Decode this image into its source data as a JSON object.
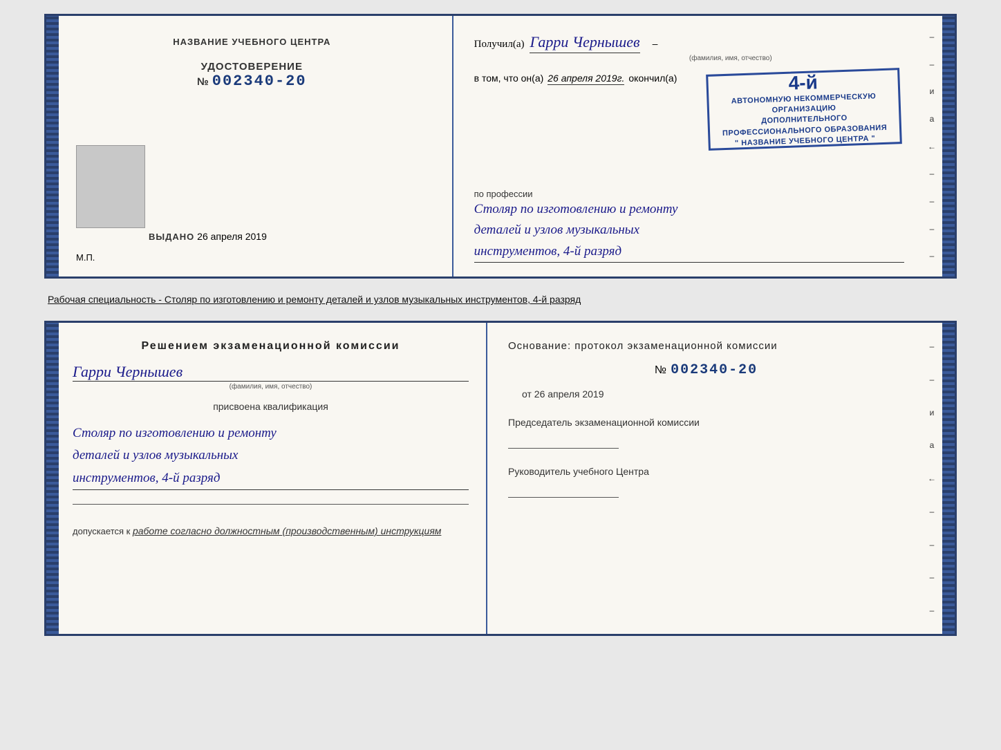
{
  "page": {
    "background_color": "#e8e8e8"
  },
  "top_cert": {
    "left": {
      "org_name": "НАЗВАНИЕ УЧЕБНОГО ЦЕНТРА",
      "cert_title": "УДОСТОВЕРЕНИЕ",
      "cert_number_prefix": "№",
      "cert_number": "002340-20",
      "issued_label": "Выдано",
      "issued_date": "26 апреля 2019",
      "mp_label": "М.П."
    },
    "right": {
      "recipient_prefix": "Получил(а)",
      "recipient_name": "Гарри Чернышев",
      "recipient_sub": "(фамилия, имя, отчество)",
      "date_prefix": "в том, что он(а)",
      "date_value": "26 апреля 2019г.",
      "date_suffix": "окончил(а)",
      "stamp_grade": "4-й",
      "stamp_line1": "АВТОНОМНУЮ НЕКОММЕРЧЕСКУЮ ОРГАНИЗАЦИЮ",
      "stamp_line2": "ДОПОЛНИТЕЛЬНОГО ПРОФЕССИОНАЛЬНОГО ОБРАЗОВАНИЯ",
      "stamp_line3": "\" НАЗВАНИЕ УЧЕБНОГО ЦЕНТРА \"",
      "profession_label": "по профессии",
      "profession_line1": "Столяр по изготовлению и ремонту",
      "profession_line2": "деталей и узлов музыкальных",
      "profession_line3": "инструментов, 4-й разряд"
    }
  },
  "caption": {
    "text": "Рабочая специальность - Столяр по изготовлению и ремонту деталей и узлов музыкальных инструментов, 4-й разряд"
  },
  "bottom_cert": {
    "left": {
      "decision_title": "Решением  экзаменационной  комиссии",
      "person_name": "Гарри Чернышев",
      "person_sub": "(фамилия, имя, отчество)",
      "qualification_label": "присвоена квалификация",
      "qualification_line1": "Столяр по изготовлению и ремонту",
      "qualification_line2": "деталей и узлов музыкальных",
      "qualification_line3": "инструментов, 4-й разряд",
      "допускается_prefix": "допускается к",
      "допускается_value": "работе согласно должностным (производственным) инструкциям"
    },
    "right": {
      "osnov_label": "Основание: протокол экзаменационной  комиссии",
      "number_prefix": "№",
      "number": "002340-20",
      "date_prefix": "от",
      "date_value": "26 апреля 2019",
      "chairman_label": "Председатель экзаменационной комиссии",
      "director_label": "Руководитель учебного Центра"
    }
  },
  "side_dashes": [
    "–",
    "–",
    "и",
    "а",
    "←",
    "–",
    "–",
    "–",
    "–"
  ]
}
